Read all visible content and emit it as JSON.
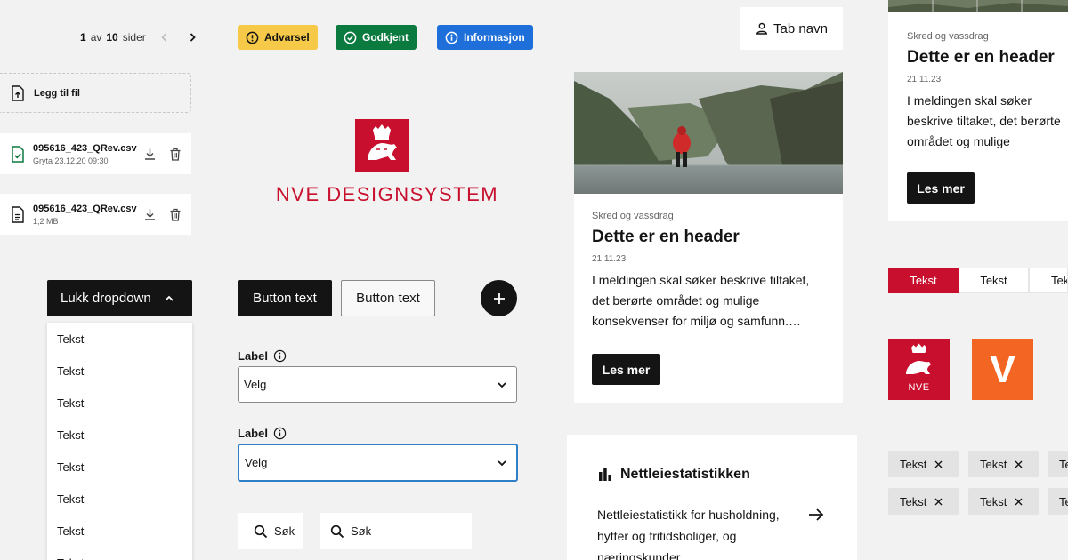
{
  "pagination": {
    "current": "1",
    "of_label": "av",
    "total": "10",
    "pages_label": "sider"
  },
  "badges": {
    "warning": "Advarsel",
    "approved": "Godkjent",
    "info": "Informasjon"
  },
  "tab_nav": {
    "label": "Tab navn"
  },
  "file_upload": {
    "add_label": "Legg til fil",
    "files": [
      {
        "name": "095616_423_QRev.csv",
        "meta": "Gryta 23.12.20  09:30"
      },
      {
        "name": "095616_423_QRev.csv",
        "meta": "1,2 MB"
      }
    ]
  },
  "brand": {
    "title": "NVE DESIGNSYSTEM",
    "logo_text": "NVE"
  },
  "article_card": {
    "category": "Skred og vassdrag",
    "title": "Dette er en header",
    "date": "21.11.23",
    "text": "I meldingen skal søker beskrive tiltaket, det berørte området og mulige konsekvenser for miljø og samfunn.…",
    "button": "Les mer"
  },
  "article_card_2": {
    "category": "Skred og vassdrag",
    "title": "Dette er en header",
    "date": "21.11.23",
    "text": "I meldingen skal søker beskrive tiltaket, det berørte området og mulige konsekvenser for miljø og samfunn",
    "button": "Les mer"
  },
  "segmented": [
    "Tekst",
    "Tekst",
    "Tekst"
  ],
  "v_logo": "V",
  "chips": [
    [
      "Tekst",
      "Tekst",
      "Tekst"
    ],
    [
      "Tekst",
      "Tekst",
      "Tekst"
    ]
  ],
  "dropdown": {
    "button": "Lukk dropdown",
    "items": [
      "Tekst",
      "Tekst",
      "Tekst",
      "Tekst",
      "Tekst",
      "Tekst",
      "Tekst",
      "Tekst"
    ]
  },
  "buttons": {
    "primary": "Button text",
    "secondary": "Button text"
  },
  "selects": [
    {
      "label": "Label",
      "value": "Velg"
    },
    {
      "label": "Label",
      "value": "Velg"
    }
  ],
  "search": {
    "a": "Søk",
    "b": "Søk"
  },
  "stats": {
    "title": "Nettleiestatistikken",
    "text": "Nettleiestatistikk for husholdning, hytter og fritidsboliger, og næringskunder"
  },
  "colors": {
    "brand_red": "#c8102e",
    "warning": "#f7c948",
    "success": "#0b7a3e",
    "info": "#1e6fd9",
    "orange": "#f26522",
    "focus": "#2f80c7"
  }
}
